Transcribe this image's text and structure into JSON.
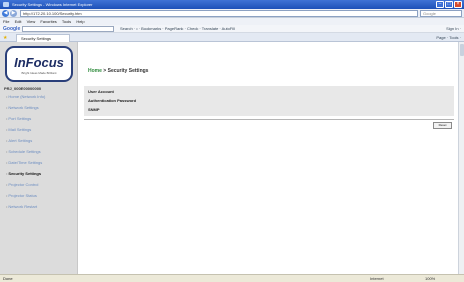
{
  "window": {
    "title": "Security Settings - Windows Internet Explorer",
    "url": "http://172.20.10.100/Security.htm",
    "search_placeholder": "Google"
  },
  "menu": [
    "File",
    "Edit",
    "View",
    "Favorites",
    "Tools",
    "Help"
  ],
  "google_toolbar": {
    "logo": "Google",
    "tools": "Search · • · Bookmarks · PageRank · Check · Translate · AutoFill",
    "signin": "Sign In ·"
  },
  "tab": {
    "label": "Security Settings"
  },
  "command_bar": "Page · Tools ·",
  "sidebar": {
    "brand": "InFocus",
    "tagline": "Bright Ideas Made Brilliant",
    "device_name": "PRJ_000E00000000",
    "items": [
      {
        "label": "Home (Network Info)"
      },
      {
        "label": "Network Settings"
      },
      {
        "label": "Port Settings"
      },
      {
        "label": "Mail Settings"
      },
      {
        "label": "Alert Settings"
      },
      {
        "label": "Schedule Settings"
      },
      {
        "label": "Date/Time Settings"
      },
      {
        "label": "Security Settings"
      },
      {
        "label": "Projector Control"
      },
      {
        "label": "Projector Status"
      },
      {
        "label": "Network Restart"
      }
    ],
    "active_index": 7
  },
  "breadcrumb": {
    "home": "Home",
    "sep": " > ",
    "current": "Security Settings"
  },
  "security_rows": [
    "User Account",
    "Authentication Password",
    "SNMP"
  ],
  "reset_button": "Reset",
  "status": {
    "done": "Done",
    "zone": "Internet",
    "zoom": "100%"
  },
  "colors": {
    "nav_link": "#6b8cc0",
    "breadcrumb_home": "#2c8a3a",
    "title_bar": "#2a5fc8"
  }
}
